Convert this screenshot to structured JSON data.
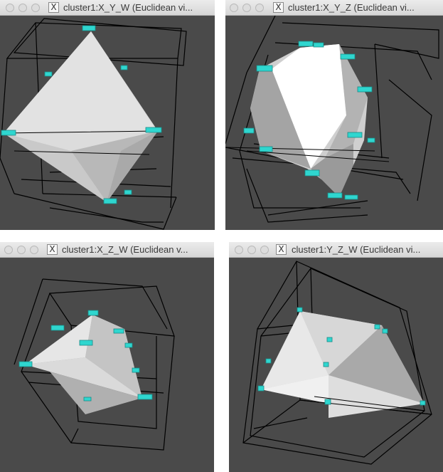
{
  "windows": [
    {
      "id": "xyw",
      "title": "cluster1:X_Y_W (Euclidean vi..."
    },
    {
      "id": "xyz",
      "title": "cluster1:X_Y_Z (Euclidean vi..."
    },
    {
      "id": "xzw",
      "title": "cluster1:X_Z_W (Euclidean v..."
    },
    {
      "id": "yzw",
      "title": "cluster1:Y_Z_W (Euclidean vi..."
    }
  ],
  "window_icon": "X",
  "icons": {
    "close": "close-dot-icon",
    "minimize": "minimize-dot-icon",
    "zoom": "zoom-dot-icon",
    "app": "x11-icon"
  },
  "colors": {
    "viewport_bg": "#4a4a4a",
    "edge_markers": "#2fd6cf",
    "wireframe": "#000000",
    "polytope_light": "#e6e6e6"
  }
}
